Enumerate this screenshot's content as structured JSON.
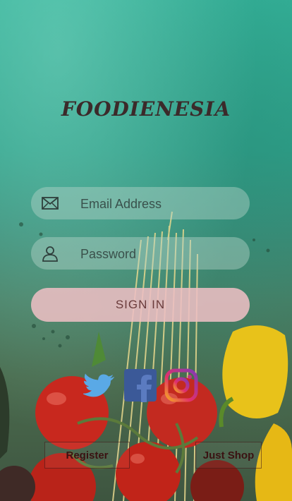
{
  "app": {
    "title": "FOODIENESIA"
  },
  "login": {
    "email_placeholder": "Email Address",
    "password_placeholder": "Password",
    "signin_label": "SIGN IN"
  },
  "social": {
    "twitter_icon": "twitter-icon",
    "facebook_icon": "facebook-icon",
    "instagram_icon": "instagram-icon"
  },
  "actions": {
    "register_label": "Register",
    "just_shop_label": "Just Shop"
  },
  "colors": {
    "background": "#2e9f88",
    "title": "#3b2a2a",
    "signin_bg": "#ecbec3",
    "twitter": "#5aa9e6",
    "facebook": "#3b5998"
  }
}
